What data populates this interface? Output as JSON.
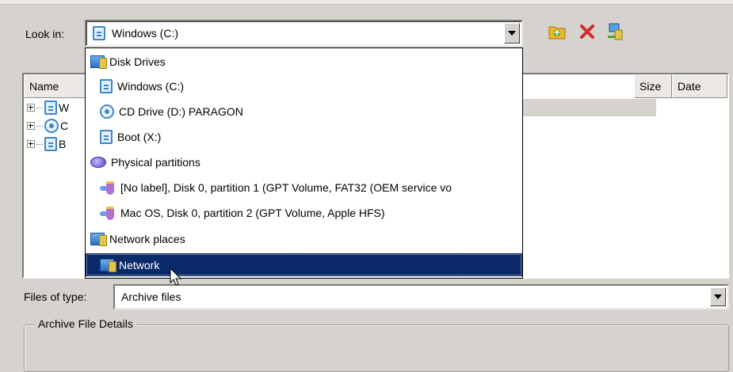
{
  "look_in": {
    "label": "Look in:",
    "value": "Windows (C:)"
  },
  "toolbar": {
    "icons": [
      "folder-up-icon",
      "delete-icon",
      "network-icon"
    ],
    "colors": {
      "delete": "#d22a2a",
      "folder": "#e8a820"
    }
  },
  "file_list": {
    "columns": [
      "Name",
      "Size",
      "Date"
    ],
    "tree_items": [
      {
        "label": "W",
        "icon": "drive-icon"
      },
      {
        "label": "C",
        "icon": "cd-drive-icon"
      },
      {
        "label": "B",
        "icon": "drive-icon"
      }
    ]
  },
  "dropdown": {
    "items": [
      {
        "label": "Disk Drives",
        "level": 0,
        "icon": "computer-icon"
      },
      {
        "label": "Windows (C:)",
        "level": 1,
        "icon": "drive-icon"
      },
      {
        "label": "CD Drive (D:) PARAGON",
        "level": 1,
        "icon": "cd-drive-icon"
      },
      {
        "label": "Boot (X:)",
        "level": 1,
        "icon": "drive-icon"
      },
      {
        "label": "Physical partitions",
        "level": 0,
        "icon": "disk-icon"
      },
      {
        "label": "[No label], Disk 0, partition 1 (GPT Volume, FAT32 (OEM service vo",
        "level": 1,
        "icon": "partition-icon"
      },
      {
        "label": "Mac OS, Disk 0, partition 2 (GPT Volume, Apple HFS)",
        "level": 1,
        "icon": "partition-icon"
      },
      {
        "label": "Network places",
        "level": 0,
        "icon": "computer-icon"
      },
      {
        "label": "Network",
        "level": 1,
        "icon": "computer-icon",
        "selected": true
      }
    ],
    "selected_color": "#0b2a6a"
  },
  "files_of_type": {
    "label": "Files of type:",
    "value": "Archive files"
  },
  "details": {
    "title": "Archive File Details"
  }
}
